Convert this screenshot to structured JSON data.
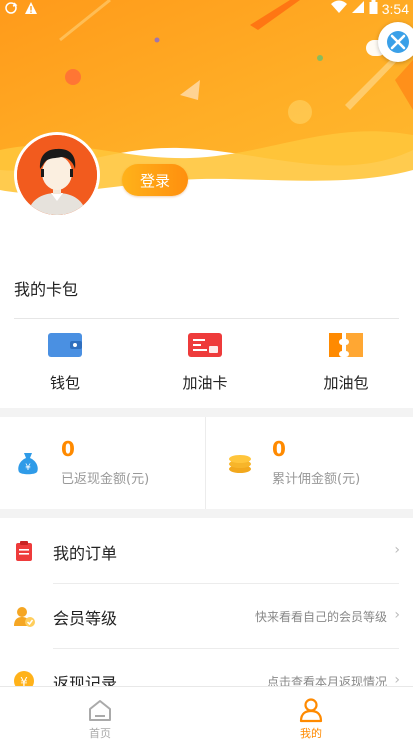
{
  "status_bar": {
    "time": "3:54"
  },
  "header": {
    "login_label": "登录",
    "colors": {
      "orange_top": "#ffab1f",
      "orange_deep": "#ff7a12",
      "wave": "#ffc43a"
    }
  },
  "card_package": {
    "title": "我的卡包",
    "items": [
      {
        "label": "钱包",
        "icon": "wallet-icon",
        "color": "#4a90e2"
      },
      {
        "label": "加油卡",
        "icon": "fuel-card-icon",
        "color": "#ee3b3b"
      },
      {
        "label": "加油包",
        "icon": "fuel-package-icon",
        "color": "#ff8a00"
      }
    ]
  },
  "stats": {
    "cashback": {
      "value": "0",
      "caption": "已返现金额(元)",
      "icon": "money-bag-icon"
    },
    "commission": {
      "value": "0",
      "caption": "累计佣金额(元)",
      "icon": "coin-stack-icon"
    }
  },
  "menu": [
    {
      "label": "我的订单",
      "hint": "",
      "icon": "order-clipboard-icon"
    },
    {
      "label": "会员等级",
      "hint": "快来看看自己的会员等级",
      "icon": "member-level-icon"
    },
    {
      "label": "返现记录",
      "hint": "点击查看本月返现情况",
      "icon": "cashback-record-icon"
    }
  ],
  "bottom_nav": [
    {
      "label": "首页",
      "icon": "home-icon",
      "active": false
    },
    {
      "label": "我的",
      "icon": "profile-icon",
      "active": true
    }
  ],
  "colors": {
    "accent": "#ff8a00",
    "inactive": "#aaaaaa"
  }
}
